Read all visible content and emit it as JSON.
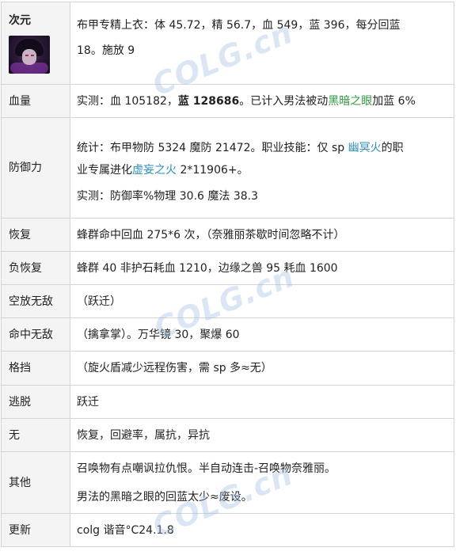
{
  "rows": [
    {
      "label": "次元",
      "lines": [
        "布甲专精上衣：体 45.72，精 56.7，血 549，蓝 396，每分回蓝",
        "18。施放 9"
      ]
    },
    {
      "label": "血量",
      "parts": [
        "实测：血 105182，",
        "蓝 128686",
        "。已计入男法被动",
        "黑暗之眼",
        "加蓝 6%"
      ]
    },
    {
      "label": "防御力",
      "stat_parts": [
        "统计：布甲物防 5324 魔防 21472。职业技能：仅 sp ",
        "幽冥火",
        "的职",
        "业专属进化",
        "虚妄之火",
        " 2*11906+。"
      ],
      "measured": "实测：防御率%物理 30.6 魔法 38.3"
    },
    {
      "label": "恢复",
      "text": "蜂群命中回血 275*6 次，（奈雅丽茶歇时间忽略不计）"
    },
    {
      "label": "负恢复",
      "text": "蜂群 40 非护石耗血 1210，边缘之兽 95 耗血 1600"
    },
    {
      "label": "空放无敌",
      "text": "（跃迁）"
    },
    {
      "label": "命中无敌",
      "text": "（擒拿掌）。万华镜 30，聚爆 60"
    },
    {
      "label": "格挡",
      "text": "（旋火盾减少远程伤害，需 sp 多≈无）"
    },
    {
      "label": "逃脱",
      "text": "跃迁"
    },
    {
      "label": "无",
      "text": "恢复，回避率，属抗，异抗"
    },
    {
      "label": "其他",
      "lines": [
        "召唤物有点嘲讽拉仇恨。半自动连击-召唤物奈雅丽。",
        "男法的黑暗之眼的回蓝太少≈废设。"
      ]
    },
    {
      "label": "更新",
      "text": "colg 谐音°C24.1.8"
    }
  ],
  "watermark": "COLG.cn",
  "colors": {
    "link_green": "#2f9a3c",
    "link_blue": "#2e8fc0",
    "label_bg": "#f4f4f4",
    "border": "#d4d4d4"
  }
}
